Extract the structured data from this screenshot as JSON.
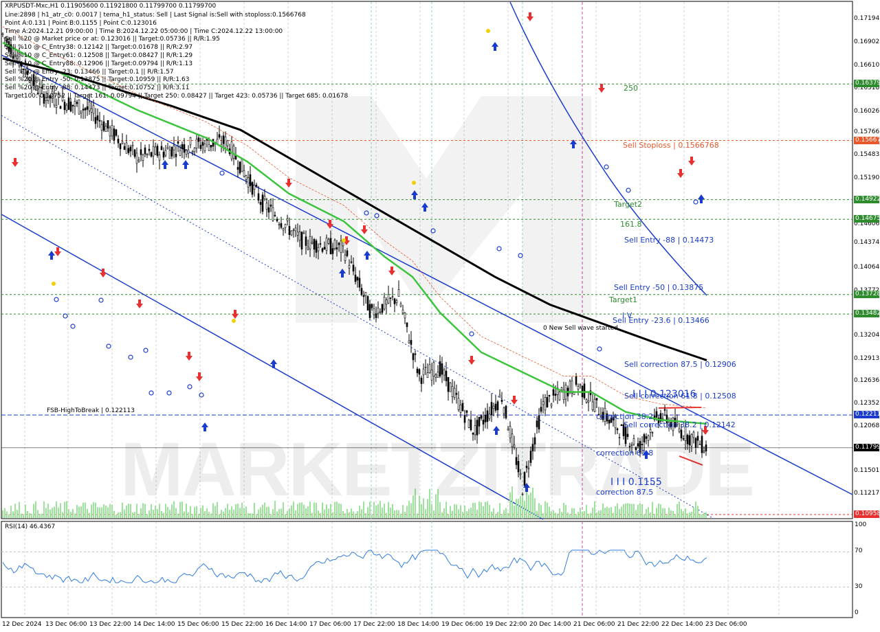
{
  "header": {
    "symbol_line": "XRPUSDT-Mxc,H1  0.11905600 0.11921800 0.11799700 0.11799700",
    "info_lines": [
      "Line:2898 | h1_atr_c0: 0.0017 | tema_h1_status: Sell | Last Signal is:Sell with stoploss:0.1566768",
      "Point A:0.131 | Point B:0.1155 | Point C:0.123016",
      "Time A:2024.12.21 09:00:00 | Time B:2024.12.22 05:00:00 | Time C:2024.12.22 13:00:00",
      "Sell %20 @ Market price or at: 0.123016 || Target:0.05736 || R/R:1.95",
      "Sell %10 @ C_Entry38: 0.12142 || Target:0.01678 || R/R:2.97",
      "Sell %10 @ C_Entry61: 0.12508 || Target:0.08427 || R/R:1.29",
      "Sell %10 @ C_Entry88: 0.12906 || Target:0.09794 || R/R:1.13",
      "Sell %10 @ Entry -23: 0.13466 || Target:0.1 || R/R:1.57",
      "Sell %20 @ Entry -50: 0.13875 || Target:0.10959 || R/R:1.63",
      "Sell %20 @ Entry -88: 0.14473 || Target:0.10752 || R/R:3.11",
      "Target100: 0.10752 || Target 161: 0.09794 || Target 250: 0.08427 || Target 423: 0.05736 || Target 685: 0.01678"
    ]
  },
  "price_axis": {
    "labels": [
      "0.17194",
      "0.16902",
      "0.16610",
      "0.16318",
      "0.16026",
      "0.15766",
      "0.15483",
      "0.15190",
      "0.14898",
      "0.14606",
      "0.14374",
      "0.14064",
      "0.13772",
      "0.13480",
      "0.13204",
      "0.12913",
      "0.12636",
      "0.12352",
      "0.12068",
      "0.11786",
      "0.11501",
      "0.11217"
    ]
  },
  "level_boxes": [
    {
      "text": "0.16379",
      "color": "#2e8b2e"
    },
    {
      "text": "0.15667",
      "color": "#e8572a"
    },
    {
      "text": "0.14922",
      "color": "#2e8b2e"
    },
    {
      "text": "0.14675",
      "color": "#2e8b2e"
    },
    {
      "text": "0.13728",
      "color": "#2e8b2e"
    },
    {
      "text": "0.13482",
      "color": "#2e8b2e"
    },
    {
      "text": "0.12211",
      "color": "#1a3ccc"
    },
    {
      "text": "0.11799",
      "color": "#000000"
    },
    {
      "text": "0.10958",
      "color": "#e83030"
    }
  ],
  "annotations": {
    "t250": "250",
    "sell_stoploss": "Sell Stoploss | 0.1566768",
    "target2": "Target2",
    "t161": "161.8",
    "sell_entry_88": "Sell Entry -88 | 0.14473",
    "sell_entry_50": "Sell Entry -50 | 0.13875",
    "target1": "Target1",
    "sell_entry_23": "Sell Entry -23.6 | 0.13466",
    "point_a": "I V",
    "new_sell_wave": "0 New Sell wave started",
    "sell_corr_875": "Sell correction 87.5 | 0.12906",
    "point_c": "I I I 0.123016",
    "sell_corr_618": "Sell correction 61.8 | 0.12508",
    "correction_382": "correction 38.2",
    "sell_corr_382": "Sell correction 38.2 | 0.12142",
    "correction_618": "correction 61.8",
    "point_b": "I I I 0.1155",
    "correction_875": "correction 87.5",
    "fsb": "FSB-HighToBreak  |  0.122113"
  },
  "watermark": "MARKETZITRADE",
  "rsi": {
    "label": "RSI(14) 46.4367",
    "levels": [
      "100",
      "70",
      "30",
      "0"
    ]
  },
  "date_axis": {
    "labels": [
      "12 Dec 2024",
      "13 Dec 06:00",
      "13 Dec 22:00",
      "14 Dec 14:00",
      "15 Dec 06:00",
      "15 Dec 22:00",
      "16 Dec 14:00",
      "17 Dec 06:00",
      "17 Dec 22:00",
      "18 Dec 14:00",
      "19 Dec 06:00",
      "19 Dec 22:00",
      "20 Dec 14:00",
      "21 Dec 06:00",
      "21 Dec 22:00",
      "22 Dec 14:00",
      "23 Dec 06:00"
    ]
  },
  "colors": {
    "green_level": "#2e8b2e",
    "stoploss": "#e8572a",
    "blue_line": "#1a3ccc",
    "ma_green": "#3cc43c",
    "ma_black": "#000000",
    "candle": "#000000"
  }
}
